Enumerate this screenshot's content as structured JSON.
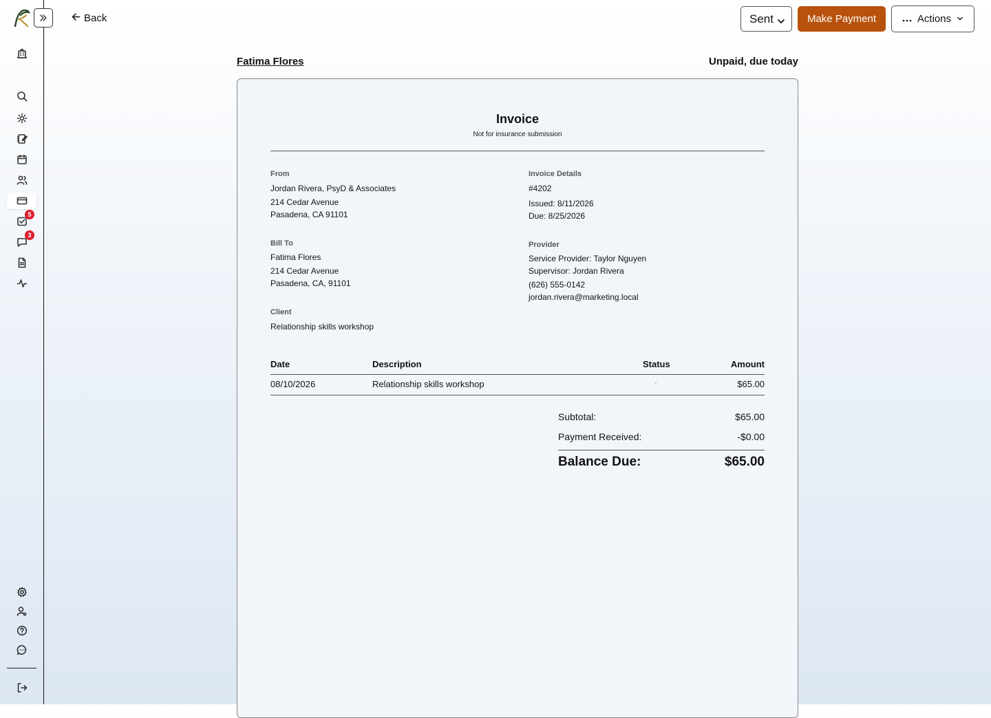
{
  "topbar": {
    "back_label": "Back",
    "status_select": {
      "selected": "Sent"
    },
    "make_payment_label": "Make Payment",
    "actions_label": "Actions"
  },
  "sidebar": {
    "badges": {
      "tasks": "5",
      "messages": "3"
    }
  },
  "header": {
    "client_name": "Fatima Flores",
    "status_text": "Unpaid, due today"
  },
  "invoice": {
    "title": "Invoice",
    "subtitle": "Not for insurance submission",
    "from": {
      "label": "From",
      "name": "Jordan Rivera, PsyD & Associates",
      "address1": "214 Cedar Avenue",
      "address2": "Pasadena, CA 91101"
    },
    "details": {
      "label": "Invoice Details",
      "number": "#4202",
      "issued": "Issued: 8/11/2026",
      "due": "Due: 8/25/2026"
    },
    "bill_to": {
      "label": "Bill To",
      "name": "Fatima Flores",
      "address1": "214 Cedar Avenue",
      "address2": "Pasadena, CA, 91101"
    },
    "provider": {
      "label": "Provider",
      "service_provider": "Service Provider: Taylor Nguyen",
      "supervisor": "Supervisor: Jordan Rivera",
      "phone": "(626) 555-0142",
      "email": "jordan.rivera@marketing.local"
    },
    "client": {
      "label": "Client",
      "value": "Relationship skills workshop"
    },
    "table": {
      "headers": {
        "date": "Date",
        "description": "Description",
        "status": "Status",
        "amount": "Amount"
      },
      "rows": [
        {
          "date": "08/10/2026",
          "description": "Relationship skills workshop",
          "status": "-",
          "amount": "$65.00"
        }
      ]
    },
    "totals": {
      "subtotal_label": "Subtotal:",
      "subtotal": "$65.00",
      "payment_label": "Payment Received:",
      "payment": "-$0.00",
      "balance_label": "Balance Due:",
      "balance": "$65.00"
    }
  }
}
